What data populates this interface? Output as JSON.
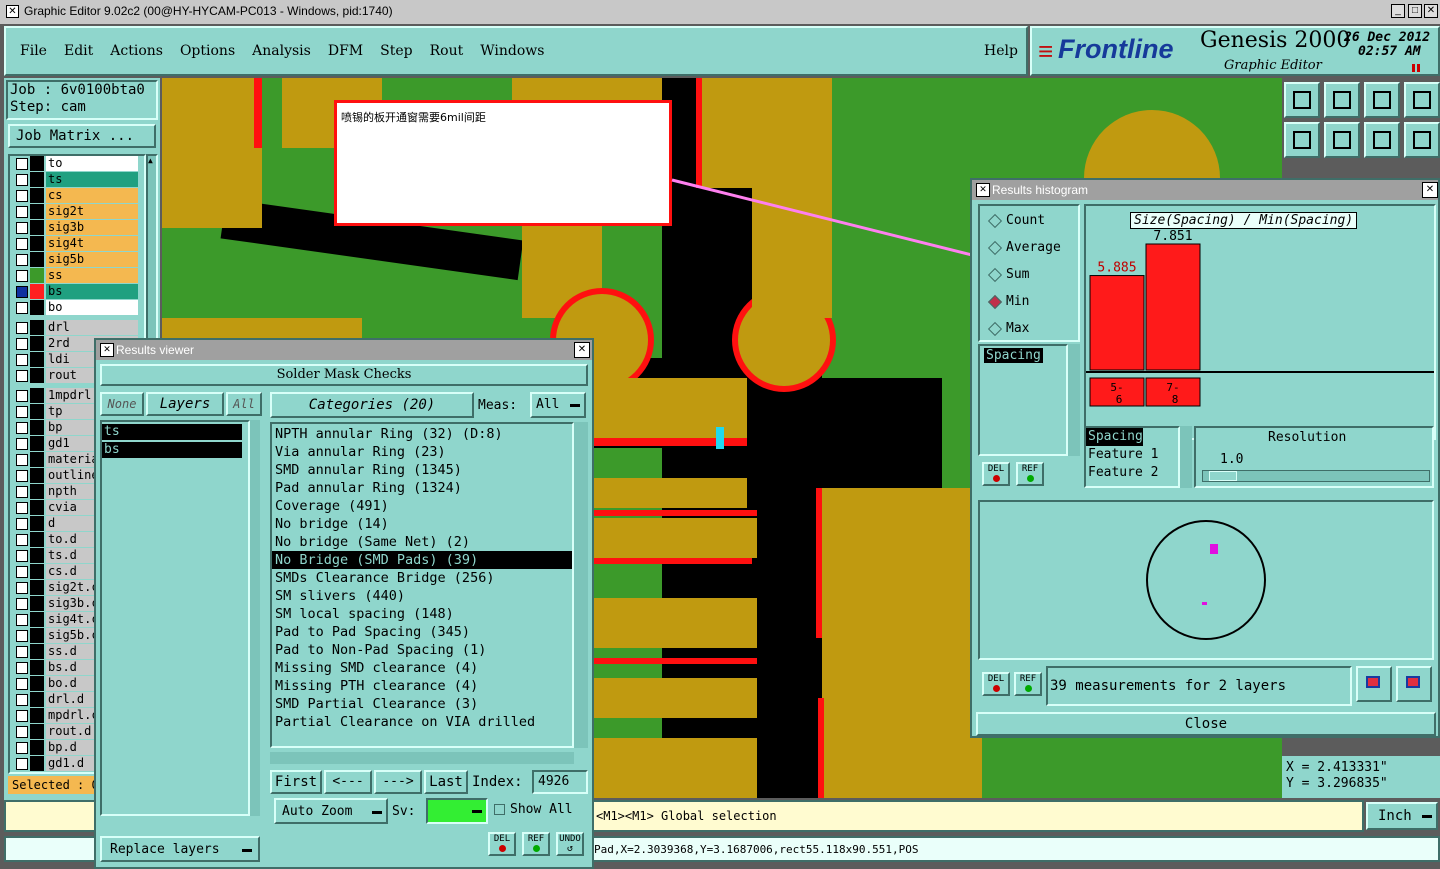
{
  "window": {
    "title": "Graphic Editor 9.02c2 (00@HY-HYCAM-PC013 - Windows, pid:1740)"
  },
  "menu": {
    "items": [
      "File",
      "Edit",
      "Actions",
      "Options",
      "Analysis",
      "DFM",
      "Step",
      "Rout",
      "Windows"
    ],
    "help": "Help"
  },
  "brand": {
    "logo": "Frontline",
    "product": "Genesis 2000",
    "subtitle": "Graphic Editor",
    "date": "26 Dec 2012",
    "time": "02:57 AM"
  },
  "job": {
    "job_label": "Job : 6v0100bta0",
    "step_label": "Step: cam",
    "matrix_button": "Job Matrix ..."
  },
  "layers": [
    {
      "name": "to",
      "color": "#ffffff",
      "num": "1"
    },
    {
      "name": "ts",
      "color": "#20a080",
      "num": "2"
    },
    {
      "name": "cs",
      "color": "#f4b850",
      "num": "3"
    },
    {
      "name": "sig2t",
      "color": "#f4b850",
      "num": "4"
    },
    {
      "name": "sig3b",
      "color": "#f4b850",
      "num": "5"
    },
    {
      "name": "sig4t",
      "color": "#f4b850",
      "num": "6"
    },
    {
      "name": "sig5b",
      "color": "#f4b850",
      "num": "7"
    },
    {
      "name": "ss",
      "color": "#f4b850",
      "num": "8"
    },
    {
      "name": "bs",
      "color": "#20a080",
      "num": "9"
    },
    {
      "name": "bo",
      "color": "#ffffff",
      "num": "10"
    },
    {
      "name": "drl",
      "color": "#c8c8c8",
      "num": "11"
    },
    {
      "name": "2rd",
      "color": "#c8c8c8",
      "num": "12"
    },
    {
      "name": "ldi",
      "color": "#c8c8c8",
      "num": "13"
    },
    {
      "name": "rout",
      "color": "#c8c8c8",
      "num": "14"
    },
    {
      "name": "1mpdrl",
      "color": "#c8c8c8",
      "num": "15"
    },
    {
      "name": "tp",
      "color": "#c8c8c8",
      "num": "16"
    },
    {
      "name": "bp",
      "color": "#c8c8c8",
      "num": "17"
    },
    {
      "name": "gd1",
      "color": "#c8c8c8",
      "num": "18"
    },
    {
      "name": "materia",
      "color": "#c8c8c8",
      "num": "19"
    },
    {
      "name": "outline",
      "color": "#c8c8c8",
      "num": "20"
    },
    {
      "name": "npth",
      "color": "#c8c8c8",
      "num": "21"
    },
    {
      "name": "cvia",
      "color": "#c8c8c8",
      "num": "22"
    },
    {
      "name": "d",
      "color": "#c8c8c8",
      "num": "23"
    },
    {
      "name": "to.d",
      "color": "#c8c8c8",
      "num": "24"
    },
    {
      "name": "ts.d",
      "color": "#c8c8c8",
      "num": "25"
    },
    {
      "name": "cs.d",
      "color": "#c8c8c8",
      "num": "26"
    },
    {
      "name": "sig2t.c",
      "color": "#c8c8c8",
      "num": "27"
    },
    {
      "name": "sig3b.c",
      "color": "#c8c8c8",
      "num": "28"
    },
    {
      "name": "sig4t.c",
      "color": "#c8c8c8",
      "num": "29"
    },
    {
      "name": "sig5b.c",
      "color": "#c8c8c8",
      "num": "30"
    },
    {
      "name": "ss.d",
      "color": "#c8c8c8",
      "num": "31"
    },
    {
      "name": "bs.d",
      "color": "#c8c8c8",
      "num": "32"
    },
    {
      "name": "bo.d",
      "color": "#c8c8c8",
      "num": "33"
    },
    {
      "name": "drl.d",
      "color": "#c8c8c8",
      "num": "34"
    },
    {
      "name": "mpdrl.c",
      "color": "#c8c8c8",
      "num": "35"
    },
    {
      "name": "rout.d",
      "color": "#c8c8c8",
      "num": "36"
    },
    {
      "name": "bp.d",
      "color": "#c8c8c8",
      "num": "37"
    },
    {
      "name": "gd1.d",
      "color": "#c8c8c8",
      "num": "38"
    }
  ],
  "selected_label": "Selected : 0",
  "annotation": {
    "text": "喷锡的板开通窗需要6mil间距"
  },
  "results_viewer": {
    "title": "Results viewer",
    "header": "Solder Mask Checks",
    "none_btn": "None",
    "layers_btn": "Layers",
    "all_btn": "All",
    "categories_btn": "Categories (20)",
    "meas_label": "Meas:",
    "meas_value": "All",
    "layer_list": [
      "ts",
      "bs"
    ],
    "categories": [
      "NPTH annular Ring (32)     (D:8)",
      "Via annular Ring (23)",
      "SMD annular Ring (1345)",
      "Pad annular Ring (1324)",
      "Coverage (491)",
      "No bridge (14)",
      "No bridge (Same Net) (2)",
      "No Bridge (SMD Pads) (39)",
      "SMDs Clearance Bridge (256)",
      "SM slivers (440)",
      "SM local spacing (148)",
      "Pad to Pad Spacing (345)",
      "Pad to Non-Pad Spacing (1)",
      "Missing SMD clearance (4)",
      "Missing PTH clearance (4)",
      "SMD Partial Clearance (3)",
      "Partial Clearance on VIA drilled"
    ],
    "selected_index": 7,
    "first_btn": "First",
    "prev_btn": "<---",
    "next_btn": "--->",
    "last_btn": "Last",
    "index_label": "Index:",
    "index_value": "4926",
    "auto_zoom": "Auto Zoom",
    "sv_label": "Sv:",
    "show_all": "Show All",
    "replace_layers": "Replace layers",
    "del_btn": "DEL",
    "ref_btn": "REF",
    "undo_btn": "UNDO"
  },
  "histogram": {
    "title": "Results histogram",
    "modes": [
      "Count",
      "Average",
      "Sum",
      "Min",
      "Max"
    ],
    "selected_mode": "Min",
    "chart_title": "Size(Spacing) / Min(Spacing)",
    "list_item": "Spacing",
    "sort_options": [
      "Spacing",
      "Feature 1",
      "Feature 2"
    ],
    "resolution_label": "Resolution",
    "resolution_value": "1.0",
    "summary": "39 measurements for 2 layers",
    "close_btn": "Close",
    "del_btn": "DEL",
    "ref_btn": "REF"
  },
  "chart_data": {
    "type": "bar",
    "categories": [
      "5-6",
      "7-8"
    ],
    "values": [
      5.885,
      7.851
    ],
    "title": "Size(Spacing) / Min(Spacing)",
    "xlabel": "",
    "ylabel": ""
  },
  "coords": {
    "x": "X = 2.413331\"",
    "y": "Y = 3.296835\""
  },
  "status": {
    "message": "<M1><M1> Global selection",
    "units": "Inch",
    "feature": "Pad,X=2.3039368,Y=3.1687006,rect55.118x90.551,POS"
  },
  "colors": {
    "panel": "#8fd6cc",
    "copper": "#c09a10",
    "board": "#3c9a2a",
    "mask": "#ff1010",
    "highlight": "#c0304a"
  }
}
